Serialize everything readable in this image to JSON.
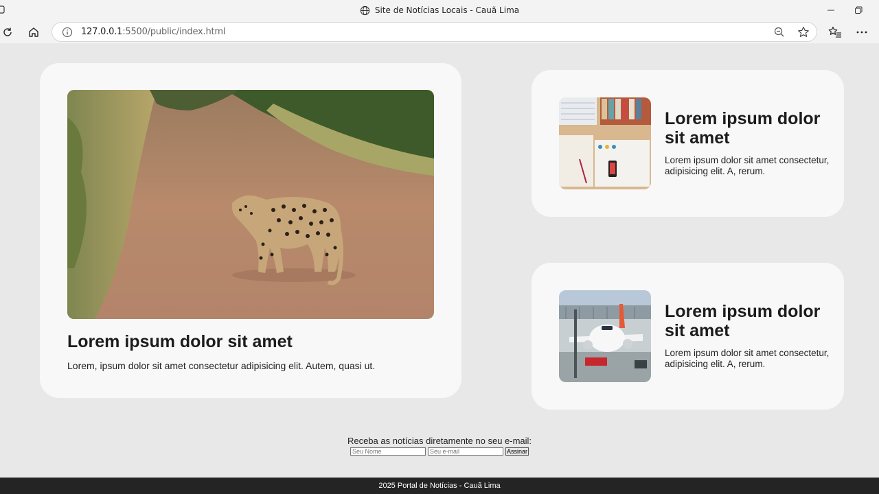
{
  "browser": {
    "window_title": "Site de Notícias Locais - Cauã Lima",
    "url_host": "127.0.0.1",
    "url_rest": ":5500/public/index.html"
  },
  "main_article": {
    "image": "leopard-on-dirt-road",
    "title": "Lorem ipsum dolor sit amet",
    "text": "Lorem, ipsum dolor sit amet consectetur adipisicing elit. Autem, quasi ut."
  },
  "side_articles": [
    {
      "image": "desk-workspace",
      "title": "Lorem ipsum dolor sit amet",
      "text": "Lorem ipsum dolor sit amet consectetur, adipisicing elit. A, rerum."
    },
    {
      "image": "airplane-at-gate",
      "title": "Lorem ipsum dolor sit amet",
      "text": "Lorem ipsum dolor sit amet consectetur, adipisicing elit. A, rerum."
    }
  ],
  "newsletter": {
    "label": "Receba as notícias diretamente no seu e-mail:",
    "name_placeholder": "Seu Nome",
    "email_placeholder": "Seu e-mail",
    "submit_label": "Assinar"
  },
  "footer": {
    "text": "2025 Portal de Notícias - Cauã Lima"
  },
  "colors": {
    "page_bg": "#e8e8e8",
    "card_bg": "#f8f8f8",
    "footer_bg": "#242424"
  }
}
